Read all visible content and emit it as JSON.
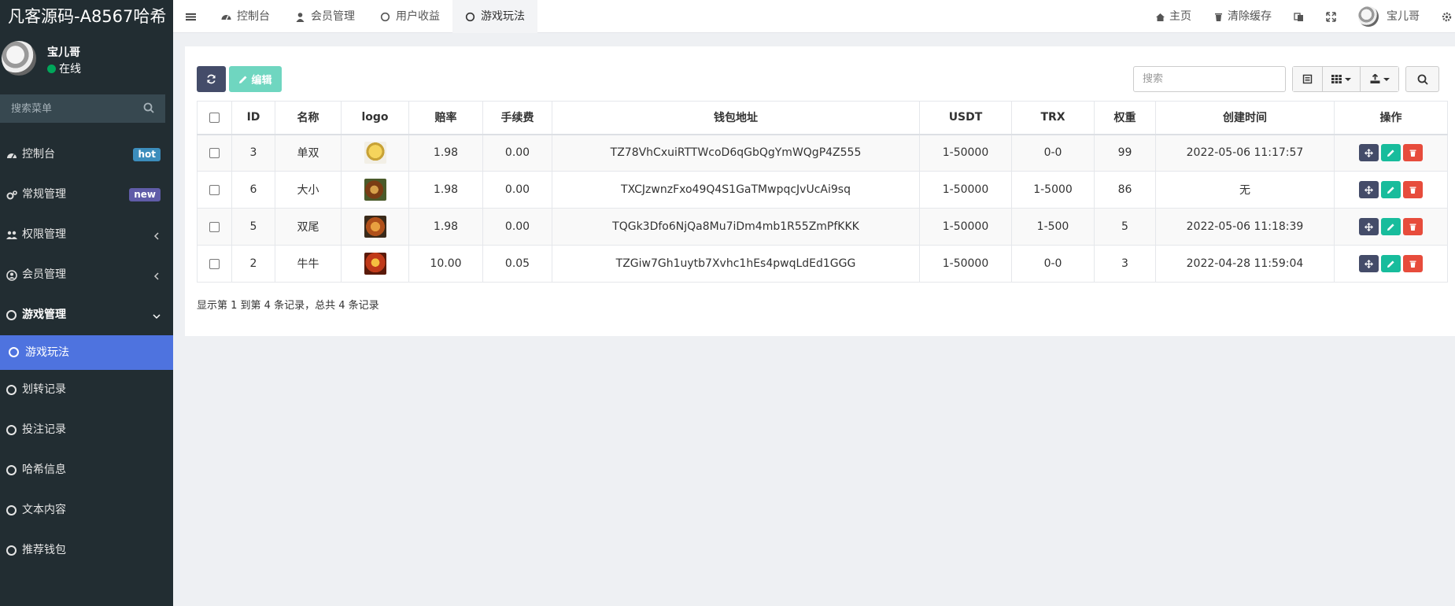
{
  "brand": "凡客源码-A8567哈希",
  "user": {
    "name": "宝儿哥",
    "status": "在线"
  },
  "sidebar": {
    "search_placeholder": "搜索菜单",
    "items": [
      {
        "label": "控制台",
        "badge": "hot"
      },
      {
        "label": "常规管理",
        "badge": "new"
      },
      {
        "label": "权限管理"
      },
      {
        "label": "会员管理"
      },
      {
        "label": "游戏管理"
      },
      {
        "label": "游戏玩法"
      },
      {
        "label": "划转记录"
      },
      {
        "label": "投注记录"
      },
      {
        "label": "哈希信息"
      },
      {
        "label": "文本内容"
      },
      {
        "label": "推荐钱包"
      }
    ]
  },
  "topbar": {
    "tabs": [
      {
        "label": "控制台",
        "icon": "dashboard-icon"
      },
      {
        "label": "会员管理",
        "icon": "user-icon"
      },
      {
        "label": "用户收益",
        "icon": "circle-icon"
      },
      {
        "label": "游戏玩法",
        "icon": "circle-icon"
      }
    ],
    "home": "主页",
    "clear_cache": "清除缓存",
    "username": "宝儿哥"
  },
  "toolbar": {
    "edit_label": "编辑",
    "search_placeholder": "搜索"
  },
  "table": {
    "headers": [
      "ID",
      "名称",
      "logo",
      "赔率",
      "手续费",
      "钱包地址",
      "USDT",
      "TRX",
      "权重",
      "创建时间",
      "操作"
    ],
    "rows": [
      {
        "id": "3",
        "name": "单双",
        "odds": "1.98",
        "fee": "0.00",
        "wallet": "TZ78VhCxuiRTTWcoD6qGbQgYmWQgP4Z555",
        "usdt": "1-50000",
        "trx": "0-0",
        "weight": "99",
        "created": "2022-05-06 11:17:57",
        "logo_color": "#e8c85a"
      },
      {
        "id": "6",
        "name": "大小",
        "odds": "1.98",
        "fee": "0.00",
        "wallet": "TXCJzwnzFxo49Q4S1GaTMwpqcJvUcAi9sq",
        "usdt": "1-50000",
        "trx": "1-5000",
        "weight": "86",
        "created": "无",
        "logo_color": "#8a4a1c"
      },
      {
        "id": "5",
        "name": "双尾",
        "odds": "1.98",
        "fee": "0.00",
        "wallet": "TQGk3Dfo6NjQa8Mu7iDm4mb1R55ZmPfKKK",
        "usdt": "1-50000",
        "trx": "1-500",
        "weight": "5",
        "created": "2022-05-06 11:18:39",
        "logo_color": "#b8561a"
      },
      {
        "id": "2",
        "name": "牛牛",
        "odds": "10.00",
        "fee": "0.05",
        "wallet": "TZGiw7Gh1uytb7Xvhc1hEs4pwqLdEd1GGG",
        "usdt": "1-50000",
        "trx": "0-0",
        "weight": "3",
        "created": "2022-04-28 11:59:04",
        "logo_color": "#c0391a"
      }
    ]
  },
  "pagination_info": "显示第 1 到第 4 条记录，总共 4 条记录"
}
